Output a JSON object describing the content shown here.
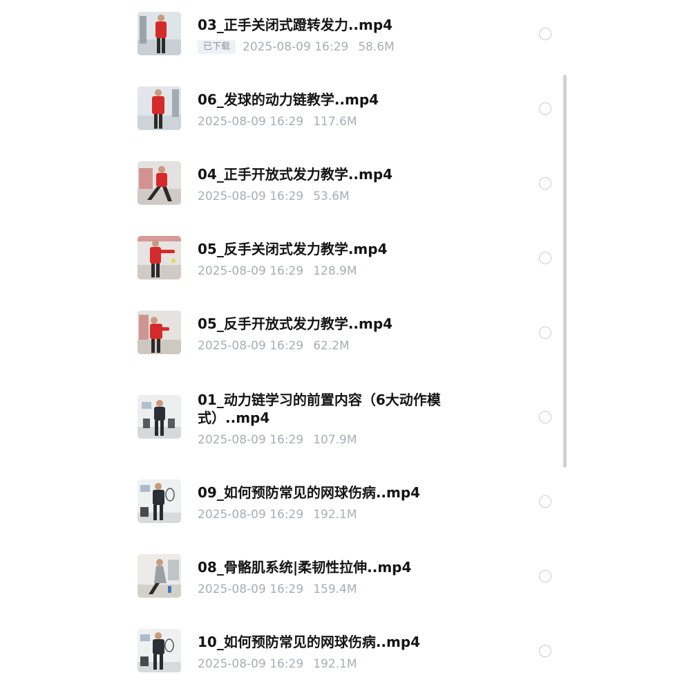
{
  "files": [
    {
      "name": "03_正手关闭式蹬转发力..mp4",
      "badge": "已下载",
      "date": "2025-08-09 16:29",
      "size": "58.6M",
      "thumb_icon": "video-thumbnail-icon"
    },
    {
      "name": "06_发球的动力链教学..mp4",
      "date": "2025-08-09 16:29",
      "size": "117.6M",
      "thumb_icon": "video-thumbnail-icon"
    },
    {
      "name": "04_正手开放式发力教学..mp4",
      "date": "2025-08-09 16:29",
      "size": "53.6M",
      "thumb_icon": "video-thumbnail-icon"
    },
    {
      "name": "05_反手关闭式发力教学.mp4",
      "date": "2025-08-09 16:29",
      "size": "128.9M",
      "thumb_icon": "video-thumbnail-icon"
    },
    {
      "name": "05_反手开放式发力教学..mp4",
      "date": "2025-08-09 16:29",
      "size": "62.2M",
      "thumb_icon": "video-thumbnail-icon"
    },
    {
      "name": "01_动力链学习的前置内容（6大动作模式）..mp4",
      "date": "2025-08-09 16:29",
      "size": "107.9M",
      "thumb_icon": "video-thumbnail-icon"
    },
    {
      "name": "09_如何预防常见的网球伤病..mp4",
      "date": "2025-08-09 16:29",
      "size": "192.1M",
      "thumb_icon": "video-thumbnail-icon"
    },
    {
      "name": "08_骨骼肌系统|柔韧性拉伸..mp4",
      "date": "2025-08-09 16:29",
      "size": "159.4M",
      "thumb_icon": "video-thumbnail-icon"
    },
    {
      "name": "10_如何预防常见的网球伤病..mp4",
      "date": "2025-08-09 16:29",
      "size": "192.1M",
      "thumb_icon": "video-thumbnail-icon"
    }
  ],
  "colors": {
    "title": "#141414",
    "meta": "#a9adb3",
    "radio_border": "#c8cbd0",
    "scrollbar": "#d0d2d6",
    "jacket_red": "#d62a2a",
    "jacket_dark": "#2b2b2b"
  }
}
